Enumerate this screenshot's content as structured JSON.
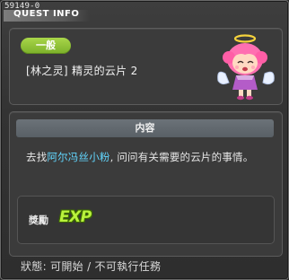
{
  "window": {
    "quest_id": "59149-0",
    "title": "QUEST INFO"
  },
  "quest": {
    "category_badge": "一般",
    "name": "[林之灵] 精灵的云片 2",
    "npc_icon": "angel-girl-npc-icon"
  },
  "content": {
    "section_title": "内容",
    "description_prefix": "去找",
    "npc_name": "阿尔冯丝小粉",
    "description_suffix": ", 问问有关需要的云片的事情。"
  },
  "reward": {
    "label": "獎勵",
    "exp_text": "EXP"
  },
  "status": {
    "text": "狀態: 可開始 / 不可執行任務"
  },
  "colors": {
    "badge_green": "#8fc33a",
    "npc_name_highlight": "#62d7ff",
    "exp_green": "#b9f23c"
  }
}
